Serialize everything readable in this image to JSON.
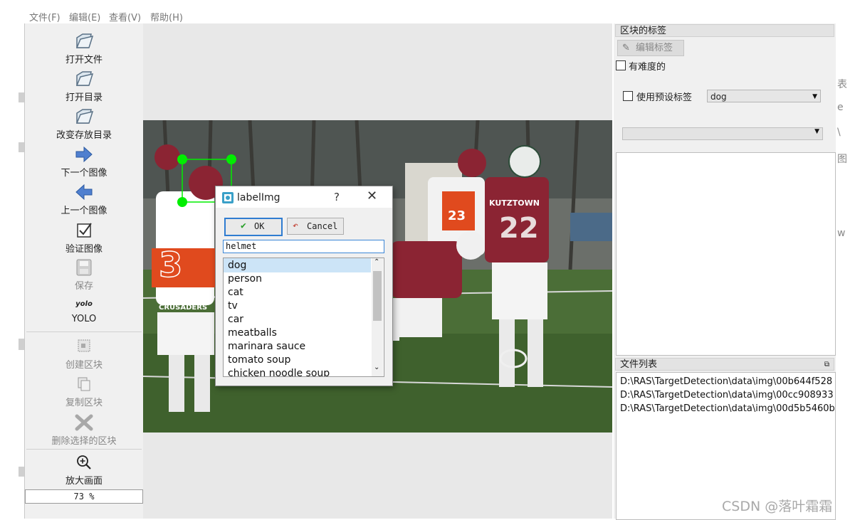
{
  "menu": [
    "文件(F)",
    "编辑(E)",
    "查看(V)",
    "帮助(H)"
  ],
  "toolbar": {
    "open_file": "打开文件",
    "open_dir": "打开目录",
    "change_save_dir": "改变存放目录",
    "next_image": "下一个图像",
    "prev_image": "上一个图像",
    "verify_image": "验证图像",
    "save": "保存",
    "yolo_icon": "yolo",
    "yolo": "YOLO",
    "create_box": "创建区块",
    "duplicate_box": "复制区块",
    "delete_box": "删除选择的区块",
    "zoom_in": "放大画面",
    "zoom_value": "73 %"
  },
  "dialog": {
    "title": "labelImg",
    "help": "?",
    "close": "✕",
    "ok": "OK",
    "cancel": "Cancel",
    "input_value": "helmet",
    "labels": [
      "dog",
      "person",
      "cat",
      "tv",
      "car",
      "meatballs",
      "marinara sauce",
      "tomato soup",
      "chicken noodle soup"
    ]
  },
  "right_panel": {
    "box_labels_title": "区块的标签",
    "edit_label": "编辑标签",
    "difficult": "有难度的",
    "use_default": "使用预设标签",
    "default_label": "dog",
    "file_list_title": "文件列表",
    "files": [
      "D:\\RAS\\TargetDetection\\data\\img\\00b644f528",
      "D:\\RAS\\TargetDetection\\data\\img\\00cc908933",
      "D:\\RAS\\TargetDetection\\data\\img\\00d5b5460b"
    ]
  },
  "photo_text": {
    "jersey_left": "3",
    "jersey_left_team": "CRUSADERS",
    "jersey_right_team": "KUTZTOWN",
    "jersey_right": "22",
    "jersey_back": "23"
  },
  "watermark": "CSDN @落叶霜霜",
  "colors": {
    "ok_border": "#2f7cd1",
    "selection": "#cce4f7",
    "bbox_handle": "#00ee00"
  }
}
